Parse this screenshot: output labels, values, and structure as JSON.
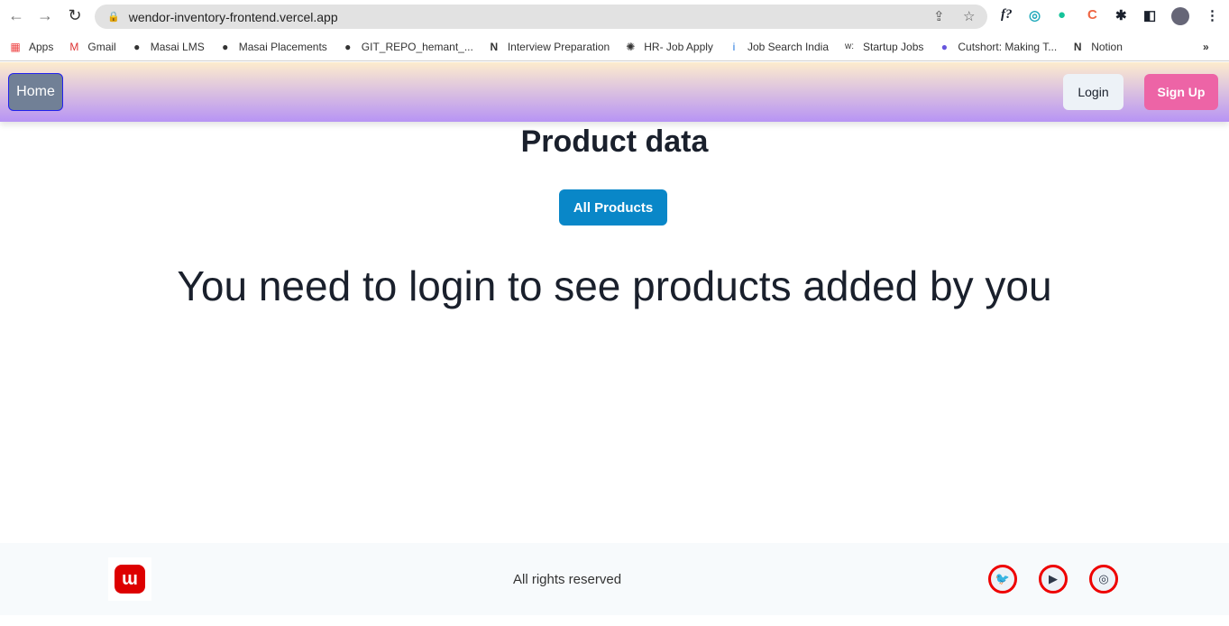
{
  "browser": {
    "url": "wendor-inventory-frontend.vercel.app",
    "bookmarks": [
      {
        "label": "Apps",
        "icon": "apps-grid-icon"
      },
      {
        "label": "Gmail",
        "icon": "gmail-icon"
      },
      {
        "label": "Masai LMS",
        "icon": "globe-icon"
      },
      {
        "label": "Masai Placements",
        "icon": "globe-icon"
      },
      {
        "label": "GIT_REPO_hemant_...",
        "icon": "github-icon"
      },
      {
        "label": "Interview Preparation",
        "icon": "notion-icon"
      },
      {
        "label": "HR- Job Apply",
        "icon": "runner-icon"
      },
      {
        "label": "Job Search India",
        "icon": "info-icon"
      },
      {
        "label": "Startup Jobs",
        "icon": "w-icon"
      },
      {
        "label": "Cutshort: Making T...",
        "icon": "cutshort-icon"
      },
      {
        "label": "Notion",
        "icon": "notion-icon"
      }
    ]
  },
  "header": {
    "home": "Home",
    "login": "Login",
    "signup": "Sign Up"
  },
  "main": {
    "title": "Product data",
    "all_products": "All Products",
    "message": "You need to login to see products added by you"
  },
  "footer": {
    "rights": "All rights reserved",
    "logo_text": "W",
    "social": [
      "twitter",
      "youtube",
      "instagram"
    ]
  }
}
